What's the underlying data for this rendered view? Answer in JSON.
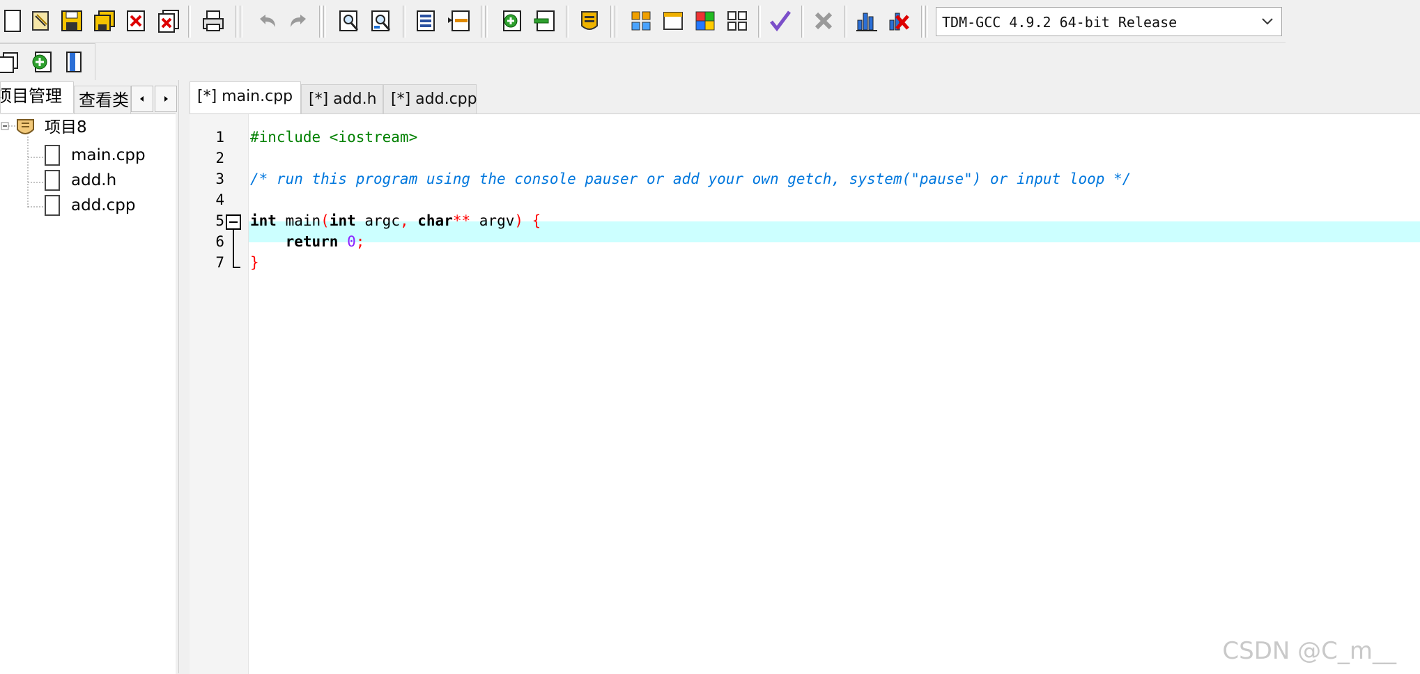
{
  "toolbar": {
    "compiler_select": "TDM-GCC 4.9.2 64-bit Release",
    "buttons": [
      "new-file",
      "open-project",
      "save",
      "save-all",
      "close",
      "close-all",
      "print",
      "undo",
      "redo",
      "find",
      "replace",
      "indent",
      "unindent",
      "add-to-project",
      "remove-from-project",
      "compile",
      "layout-1",
      "layout-2",
      "layout-3",
      "layout-4",
      "check-syntax",
      "stop",
      "profile",
      "delete-profile"
    ]
  },
  "left_panel": {
    "tabs": [
      "项目管理",
      "查看类"
    ],
    "project": {
      "name": "项目8",
      "files": [
        "main.cpp",
        "add.h",
        "add.cpp"
      ]
    }
  },
  "editor": {
    "tabs": [
      "[*] main.cpp",
      "[*] add.h",
      "[*] add.cpp"
    ],
    "active_tab": "[*] main.cpp",
    "line_numbers": [
      "1",
      "2",
      "3",
      "4",
      "5",
      "6",
      "7"
    ],
    "lines": {
      "l1": "#include <iostream>",
      "l3": "/* run this program using the console pauser or add your own getch, system(\"pause\") or input loop */",
      "l5_int": "int",
      "l5_main": " main",
      "l5_paren_open": "(",
      "l5_int2": "int",
      "l5_argc": " argc",
      "l5_comma": ",",
      "l5_char": " char",
      "l5_stars": "**",
      "l5_argv": " argv",
      "l5_close": ")",
      "l5_brace": " {",
      "l6_return": "    return",
      "l6_zero": "0",
      "l6_semi": ";",
      "l7_brace": "}"
    },
    "highlight_color": "#ccffff"
  },
  "watermark": "CSDN @C_m__"
}
